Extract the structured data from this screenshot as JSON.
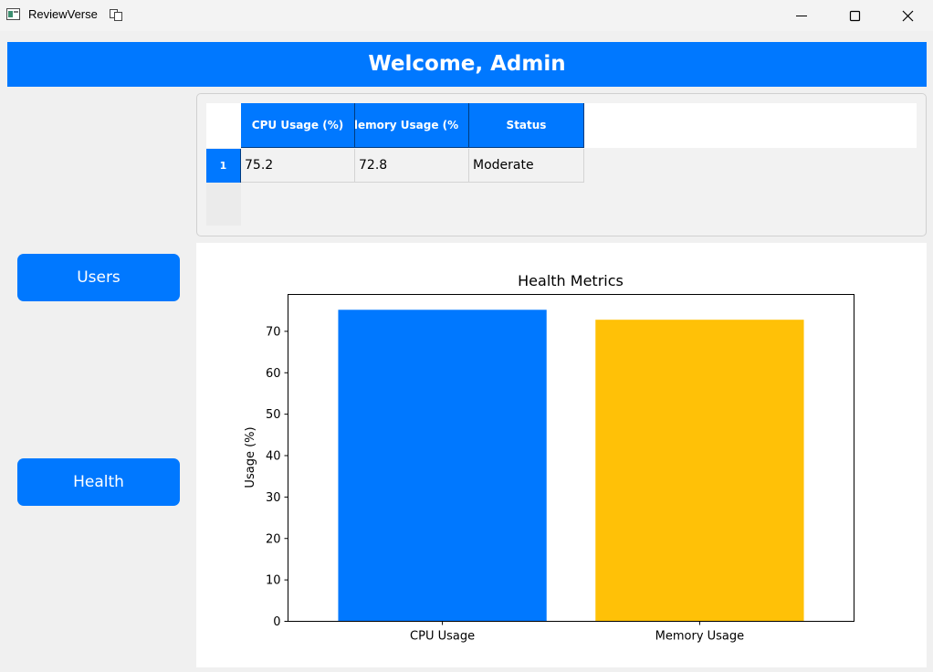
{
  "window": {
    "title": "ReviewVerse"
  },
  "header": {
    "welcome": "Welcome, Admin"
  },
  "sidebar": {
    "users_label": "Users",
    "health_label": "Health"
  },
  "table": {
    "columns": [
      "CPU Usage (%)",
      "Memory Usage (%)",
      "Status"
    ],
    "visible_headers": [
      "CPU Usage (%)",
      "lemory Usage (%",
      "Status"
    ],
    "rows": [
      {
        "index": "1",
        "cells": [
          "75.2",
          "72.8",
          "Moderate"
        ]
      }
    ]
  },
  "colors": {
    "accent": "#0078ff",
    "memory_bar": "#ffc107"
  },
  "chart_data": {
    "type": "bar",
    "title": "Health Metrics",
    "xlabel": "",
    "ylabel": "Usage (%)",
    "categories": [
      "CPU Usage",
      "Memory Usage"
    ],
    "values": [
      75.2,
      72.8
    ],
    "colors": [
      "#0078ff",
      "#ffc107"
    ],
    "ylim": [
      0,
      78.9
    ],
    "yticks": [
      0,
      10,
      20,
      30,
      40,
      50,
      60,
      70
    ],
    "grid": false
  }
}
